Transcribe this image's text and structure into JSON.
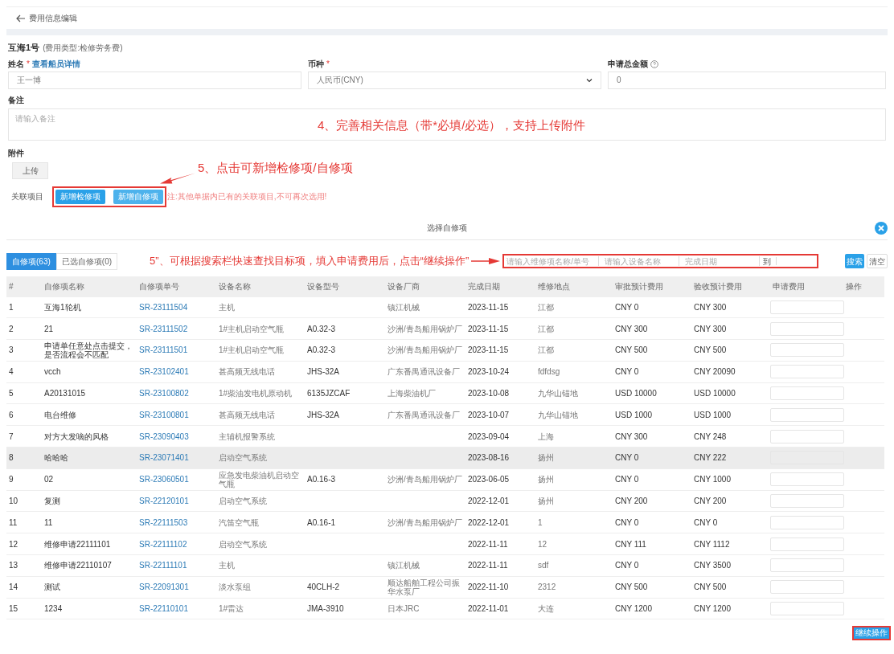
{
  "header": {
    "title": "费用信息编辑"
  },
  "vessel": {
    "name": "互海1号",
    "type": "(费用类型:检修劳务费)"
  },
  "fields": [
    {
      "label": "姓名",
      "required_mark": "*",
      "help": false,
      "link": "查看船员详情",
      "value": "王一博",
      "kind": "text"
    },
    {
      "label": "币种",
      "required_mark": "*",
      "help": false,
      "value": "人民币(CNY)",
      "kind": "select"
    },
    {
      "label": "申请总金额",
      "help": true,
      "value": "0",
      "kind": "text"
    }
  ],
  "remark": {
    "label": "备注",
    "placeholder": "请输入备注"
  },
  "attachment": {
    "label": "附件",
    "button": "上传"
  },
  "related": {
    "label": "关联项目",
    "buttons": [
      "新增检修项",
      "新增自修项"
    ],
    "note": "注:其他单据内已有的关联项目,不可再次选用!"
  },
  "annotations": [
    "4、完善相关信息（带*必填/必选），支持上传附件",
    "5、点击可新增检修项/自修项",
    "5”、可根据搜索栏快速查找目标项，填入申请费用后，点击“继续操作”"
  ],
  "dialog": {
    "title": "选择自修项",
    "tabs": [
      {
        "label": "自修项(63)",
        "selected": true
      },
      {
        "label": "已选自修项(0)",
        "selected": false
      }
    ],
    "search": {
      "placeholders": [
        "请输入维修项名称/单号",
        "请输入设备名称",
        "完成日期"
      ],
      "range_separator": "到",
      "buttons": [
        "搜索",
        "清空"
      ]
    },
    "columns": [
      "#",
      "自修项名称",
      "自修项单号",
      "设备名称",
      "设备型号",
      "设备厂商",
      "完成日期",
      "维修地点",
      "审批预计费用",
      "验收预计费用",
      "申请费用",
      "操作"
    ],
    "rows": [
      {
        "cells": [
          "1",
          "互海1轮机",
          "SR-23111504",
          "主机",
          "",
          "镇江机械",
          "2023-11-15",
          "江都",
          "CNY 0",
          "CNY 300"
        ],
        "highlighted": false
      },
      {
        "cells": [
          "2",
          "21",
          "SR-23111502",
          "1#主机启动空气瓶",
          "A0.32-3",
          "沙洲/青岛船用锅炉厂",
          "2023-11-15",
          "江都",
          "CNY 300",
          "CNY 300"
        ],
        "highlighted": false
      },
      {
        "cells": [
          "3",
          "申请单任意处点击提交，是否流程会不匹配",
          "SR-23111501",
          "1#主机启动空气瓶",
          "A0.32-3",
          "沙洲/青岛船用锅炉厂",
          "2023-11-15",
          "江都",
          "CNY 500",
          "CNY 500"
        ],
        "highlighted": false
      },
      {
        "cells": [
          "4",
          "vcch",
          "SR-23102401",
          "甚高频无线电话",
          "JHS-32A",
          "广东番禺通讯设备厂",
          "2023-10-24",
          "fdfdsg",
          "CNY 0",
          "CNY 20090"
        ],
        "highlighted": false
      },
      {
        "cells": [
          "5",
          "A20131015",
          "SR-23100802",
          "1#柴油发电机原动机",
          "6135JZCAF",
          "上海柴油机厂",
          "2023-10-08",
          "九华山锚地",
          "USD 10000",
          "USD 10000"
        ],
        "highlighted": false
      },
      {
        "cells": [
          "6",
          "电台维修",
          "SR-23100801",
          "甚高频无线电话",
          "JHS-32A",
          "广东番禺通讯设备厂",
          "2023-10-07",
          "九华山锚地",
          "USD 1000",
          "USD 1000"
        ],
        "highlighted": false
      },
      {
        "cells": [
          "7",
          "对方大发嘀的风格",
          "SR-23090403",
          "主辅机报警系统",
          "",
          "",
          "2023-09-04",
          "上海",
          "CNY 300",
          "CNY 248"
        ],
        "highlighted": false
      },
      {
        "cells": [
          "8",
          "哈哈哈",
          "SR-23071401",
          "启动空气系统",
          "",
          "",
          "2023-08-16",
          "扬州",
          "CNY 0",
          "CNY 222"
        ],
        "highlighted": true
      },
      {
        "cells": [
          "9",
          "02",
          "SR-23060501",
          "应急发电柴油机启动空气瓶",
          "A0.16-3",
          "沙洲/青岛船用锅炉厂",
          "2023-06-05",
          "扬州",
          "CNY 0",
          "CNY 1000"
        ],
        "highlighted": false
      },
      {
        "cells": [
          "10",
          "复测",
          "SR-22120101",
          "启动空气系统",
          "",
          "",
          "2022-12-01",
          "扬州",
          "CNY 200",
          "CNY 200"
        ],
        "highlighted": false
      },
      {
        "cells": [
          "11",
          "11",
          "SR-22111503",
          "汽笛空气瓶",
          "A0.16-1",
          "沙洲/青岛船用锅炉厂",
          "2022-12-01",
          "1",
          "CNY 0",
          "CNY 0"
        ],
        "highlighted": false
      },
      {
        "cells": [
          "12",
          "维修申请22111101",
          "SR-22111102",
          "启动空气系统",
          "",
          "",
          "2022-11-11",
          "12",
          "CNY 111",
          "CNY 1112"
        ],
        "highlighted": false
      },
      {
        "cells": [
          "13",
          "维修申请22110107",
          "SR-22111101",
          "主机",
          "",
          "镇江机械",
          "2022-11-11",
          "sdf",
          "CNY 0",
          "CNY 3500"
        ],
        "highlighted": false
      },
      {
        "cells": [
          "14",
          "测试",
          "SR-22091301",
          "淡水泵组",
          "40CLH-2",
          "顺达船舶工程公司振华水泵厂",
          "2022-11-10",
          "2312",
          "CNY 500",
          "CNY 500"
        ],
        "highlighted": false
      },
      {
        "cells": [
          "15",
          "1234",
          "SR-22110101",
          "1#雷达",
          "JMA-3910",
          "日本JRC",
          "2022-11-01",
          "大连",
          "CNY 1200",
          "CNY 1200"
        ],
        "highlighted": false
      }
    ],
    "continue_button": "继续操作"
  }
}
